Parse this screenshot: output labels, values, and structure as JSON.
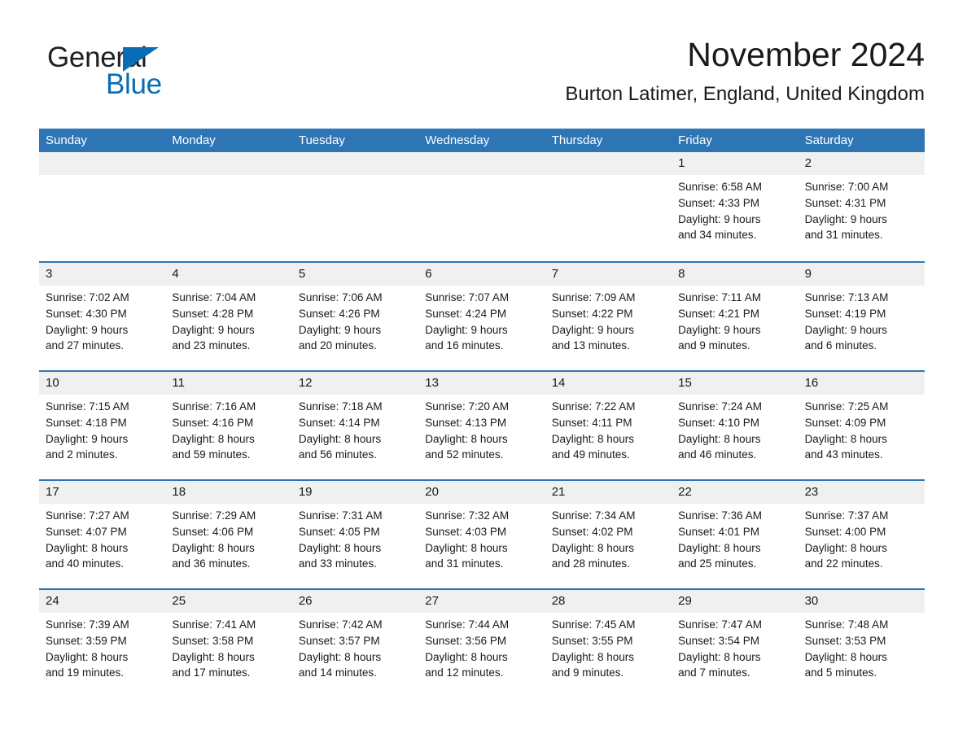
{
  "brand": {
    "name_dark": "General",
    "name_blue": "Blue",
    "triangle_color": "#0a6cb5"
  },
  "header": {
    "title": "November 2024",
    "subtitle": "Burton Latimer, England, United Kingdom",
    "accent_color": "#2e75b6"
  },
  "weekdays": [
    "Sunday",
    "Monday",
    "Tuesday",
    "Wednesday",
    "Thursday",
    "Friday",
    "Saturday"
  ],
  "weeks": [
    [
      {
        "day": "",
        "lines": []
      },
      {
        "day": "",
        "lines": []
      },
      {
        "day": "",
        "lines": []
      },
      {
        "day": "",
        "lines": []
      },
      {
        "day": "",
        "lines": []
      },
      {
        "day": "1",
        "lines": [
          "Sunrise: 6:58 AM",
          "Sunset: 4:33 PM",
          "Daylight: 9 hours",
          "and 34 minutes."
        ]
      },
      {
        "day": "2",
        "lines": [
          "Sunrise: 7:00 AM",
          "Sunset: 4:31 PM",
          "Daylight: 9 hours",
          "and 31 minutes."
        ]
      }
    ],
    [
      {
        "day": "3",
        "lines": [
          "Sunrise: 7:02 AM",
          "Sunset: 4:30 PM",
          "Daylight: 9 hours",
          "and 27 minutes."
        ]
      },
      {
        "day": "4",
        "lines": [
          "Sunrise: 7:04 AM",
          "Sunset: 4:28 PM",
          "Daylight: 9 hours",
          "and 23 minutes."
        ]
      },
      {
        "day": "5",
        "lines": [
          "Sunrise: 7:06 AM",
          "Sunset: 4:26 PM",
          "Daylight: 9 hours",
          "and 20 minutes."
        ]
      },
      {
        "day": "6",
        "lines": [
          "Sunrise: 7:07 AM",
          "Sunset: 4:24 PM",
          "Daylight: 9 hours",
          "and 16 minutes."
        ]
      },
      {
        "day": "7",
        "lines": [
          "Sunrise: 7:09 AM",
          "Sunset: 4:22 PM",
          "Daylight: 9 hours",
          "and 13 minutes."
        ]
      },
      {
        "day": "8",
        "lines": [
          "Sunrise: 7:11 AM",
          "Sunset: 4:21 PM",
          "Daylight: 9 hours",
          "and 9 minutes."
        ]
      },
      {
        "day": "9",
        "lines": [
          "Sunrise: 7:13 AM",
          "Sunset: 4:19 PM",
          "Daylight: 9 hours",
          "and 6 minutes."
        ]
      }
    ],
    [
      {
        "day": "10",
        "lines": [
          "Sunrise: 7:15 AM",
          "Sunset: 4:18 PM",
          "Daylight: 9 hours",
          "and 2 minutes."
        ]
      },
      {
        "day": "11",
        "lines": [
          "Sunrise: 7:16 AM",
          "Sunset: 4:16 PM",
          "Daylight: 8 hours",
          "and 59 minutes."
        ]
      },
      {
        "day": "12",
        "lines": [
          "Sunrise: 7:18 AM",
          "Sunset: 4:14 PM",
          "Daylight: 8 hours",
          "and 56 minutes."
        ]
      },
      {
        "day": "13",
        "lines": [
          "Sunrise: 7:20 AM",
          "Sunset: 4:13 PM",
          "Daylight: 8 hours",
          "and 52 minutes."
        ]
      },
      {
        "day": "14",
        "lines": [
          "Sunrise: 7:22 AM",
          "Sunset: 4:11 PM",
          "Daylight: 8 hours",
          "and 49 minutes."
        ]
      },
      {
        "day": "15",
        "lines": [
          "Sunrise: 7:24 AM",
          "Sunset: 4:10 PM",
          "Daylight: 8 hours",
          "and 46 minutes."
        ]
      },
      {
        "day": "16",
        "lines": [
          "Sunrise: 7:25 AM",
          "Sunset: 4:09 PM",
          "Daylight: 8 hours",
          "and 43 minutes."
        ]
      }
    ],
    [
      {
        "day": "17",
        "lines": [
          "Sunrise: 7:27 AM",
          "Sunset: 4:07 PM",
          "Daylight: 8 hours",
          "and 40 minutes."
        ]
      },
      {
        "day": "18",
        "lines": [
          "Sunrise: 7:29 AM",
          "Sunset: 4:06 PM",
          "Daylight: 8 hours",
          "and 36 minutes."
        ]
      },
      {
        "day": "19",
        "lines": [
          "Sunrise: 7:31 AM",
          "Sunset: 4:05 PM",
          "Daylight: 8 hours",
          "and 33 minutes."
        ]
      },
      {
        "day": "20",
        "lines": [
          "Sunrise: 7:32 AM",
          "Sunset: 4:03 PM",
          "Daylight: 8 hours",
          "and 31 minutes."
        ]
      },
      {
        "day": "21",
        "lines": [
          "Sunrise: 7:34 AM",
          "Sunset: 4:02 PM",
          "Daylight: 8 hours",
          "and 28 minutes."
        ]
      },
      {
        "day": "22",
        "lines": [
          "Sunrise: 7:36 AM",
          "Sunset: 4:01 PM",
          "Daylight: 8 hours",
          "and 25 minutes."
        ]
      },
      {
        "day": "23",
        "lines": [
          "Sunrise: 7:37 AM",
          "Sunset: 4:00 PM",
          "Daylight: 8 hours",
          "and 22 minutes."
        ]
      }
    ],
    [
      {
        "day": "24",
        "lines": [
          "Sunrise: 7:39 AM",
          "Sunset: 3:59 PM",
          "Daylight: 8 hours",
          "and 19 minutes."
        ]
      },
      {
        "day": "25",
        "lines": [
          "Sunrise: 7:41 AM",
          "Sunset: 3:58 PM",
          "Daylight: 8 hours",
          "and 17 minutes."
        ]
      },
      {
        "day": "26",
        "lines": [
          "Sunrise: 7:42 AM",
          "Sunset: 3:57 PM",
          "Daylight: 8 hours",
          "and 14 minutes."
        ]
      },
      {
        "day": "27",
        "lines": [
          "Sunrise: 7:44 AM",
          "Sunset: 3:56 PM",
          "Daylight: 8 hours",
          "and 12 minutes."
        ]
      },
      {
        "day": "28",
        "lines": [
          "Sunrise: 7:45 AM",
          "Sunset: 3:55 PM",
          "Daylight: 8 hours",
          "and 9 minutes."
        ]
      },
      {
        "day": "29",
        "lines": [
          "Sunrise: 7:47 AM",
          "Sunset: 3:54 PM",
          "Daylight: 8 hours",
          "and 7 minutes."
        ]
      },
      {
        "day": "30",
        "lines": [
          "Sunrise: 7:48 AM",
          "Sunset: 3:53 PM",
          "Daylight: 8 hours",
          "and 5 minutes."
        ]
      }
    ]
  ]
}
